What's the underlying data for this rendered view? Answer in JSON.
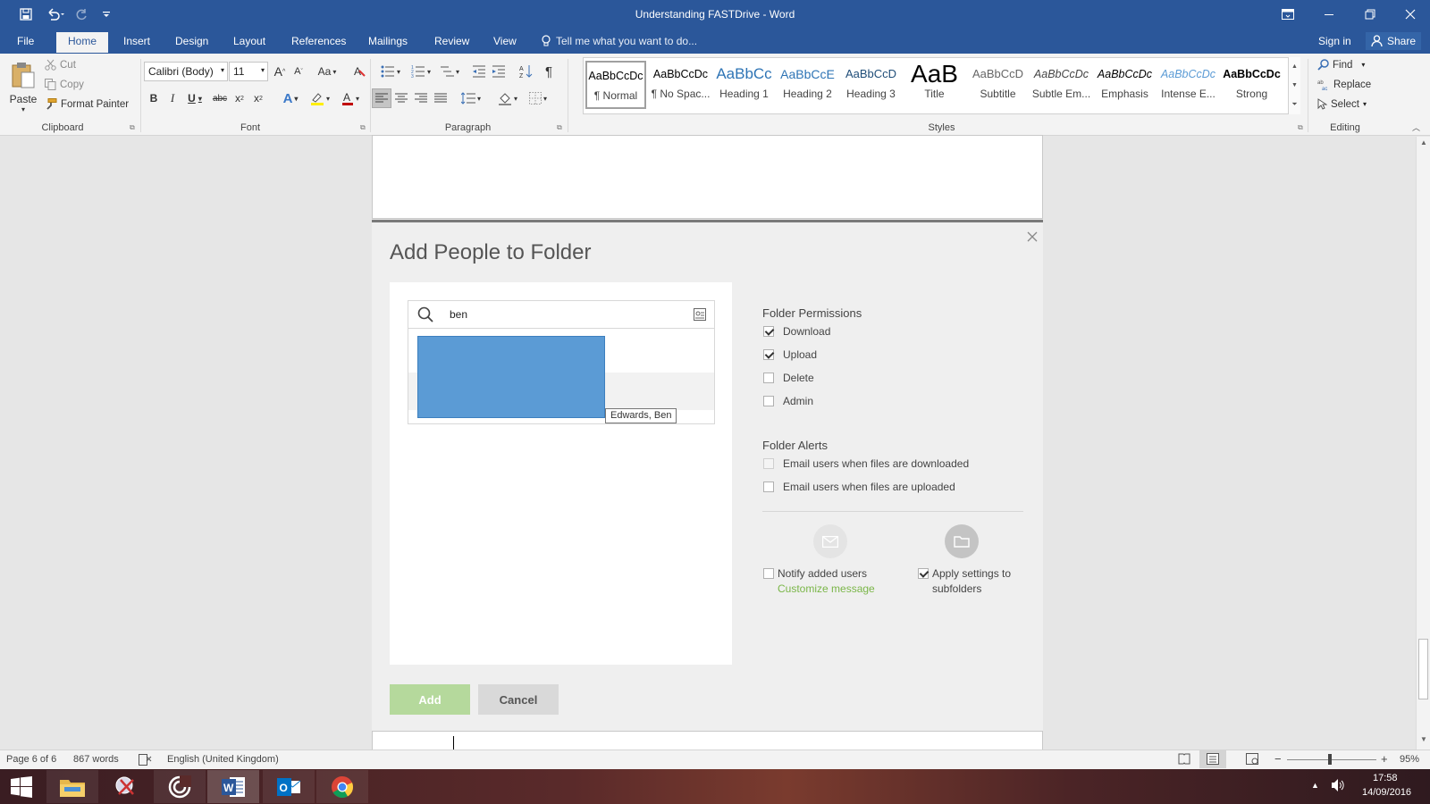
{
  "window": {
    "title": "Understanding FASTDrive - Word"
  },
  "tabs": [
    "File",
    "Home",
    "Insert",
    "Design",
    "Layout",
    "References",
    "Mailings",
    "Review",
    "View"
  ],
  "tell_me": "Tell me what you want to do...",
  "account": {
    "sign_in": "Sign in",
    "share": "Share"
  },
  "clipboard": {
    "paste": "Paste",
    "cut": "Cut",
    "copy": "Copy",
    "format_painter": "Format Painter",
    "label": "Clipboard"
  },
  "font": {
    "name": "Calibri (Body)",
    "size": "11",
    "change_case": "Aa",
    "label": "Font"
  },
  "paragraph": {
    "label": "Paragraph"
  },
  "styles": {
    "label": "Styles",
    "items": [
      {
        "preview": "AaBbCcDc",
        "name": "¶ Normal"
      },
      {
        "preview": "AaBbCcDc",
        "name": "¶ No Spac..."
      },
      {
        "preview": "AaBbCc",
        "name": "Heading 1"
      },
      {
        "preview": "AaBbCcE",
        "name": "Heading 2"
      },
      {
        "preview": "AaBbCcD",
        "name": "Heading 3"
      },
      {
        "preview": "AaB",
        "name": "Title"
      },
      {
        "preview": "AaBbCcD",
        "name": "Subtitle"
      },
      {
        "preview": "AaBbCcDc",
        "name": "Subtle Em..."
      },
      {
        "preview": "AaBbCcDc",
        "name": "Emphasis"
      },
      {
        "preview": "AaBbCcDc",
        "name": "Intense E..."
      },
      {
        "preview": "AaBbCcDc",
        "name": "Strong"
      }
    ]
  },
  "editing": {
    "find": "Find",
    "replace": "Replace",
    "select": "Select",
    "label": "Editing"
  },
  "dialog": {
    "title": "Add People to Folder",
    "search_value": "ben",
    "tooltip": "Edwards, Ben",
    "permissions_title": "Folder Permissions",
    "permissions": [
      {
        "label": "Download",
        "checked": true
      },
      {
        "label": "Upload",
        "checked": true
      },
      {
        "label": "Delete",
        "checked": false
      },
      {
        "label": "Admin",
        "checked": false
      }
    ],
    "alerts_title": "Folder Alerts",
    "alerts": [
      {
        "label": "Email users when files are downloaded",
        "checked": false
      },
      {
        "label": "Email users when files are uploaded",
        "checked": false
      }
    ],
    "notify_label": "Notify added users",
    "customize_link": "Customize message",
    "apply_label_1": "Apply settings to",
    "apply_label_2": "subfolders",
    "add_button": "Add",
    "cancel_button": "Cancel",
    "colors": {
      "selection": "#5b9bd5",
      "link": "#7ab648",
      "add_button": "#b5d99c"
    }
  },
  "statusbar": {
    "page": "Page 6 of 6",
    "words": "867 words",
    "language": "English (United Kingdom)",
    "zoom": "95%"
  },
  "taskbar": {
    "time": "17:58",
    "date": "14/09/2016"
  }
}
